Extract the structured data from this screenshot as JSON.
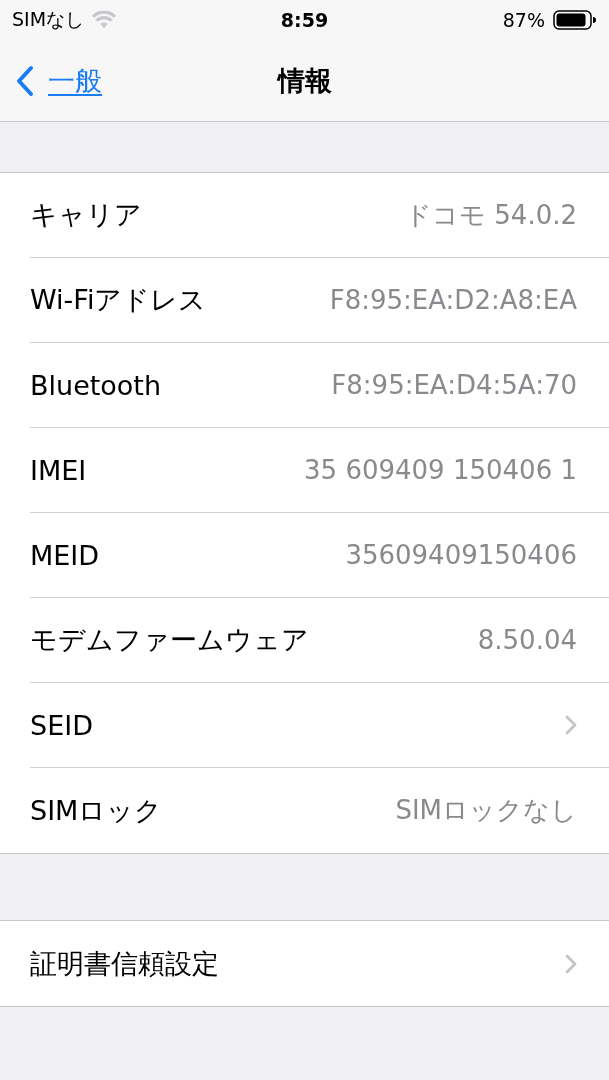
{
  "status_bar": {
    "carrier": "SIMなし",
    "time": "8:59",
    "battery": "87%"
  },
  "nav": {
    "back": "一般",
    "title": "情報"
  },
  "sections": [
    {
      "rows": [
        {
          "kind": "value",
          "label": "キャリア",
          "value": "ドコモ 54.0.2"
        },
        {
          "kind": "value",
          "label": "Wi-Fiアドレス",
          "value": "F8:95:EA:D2:A8:EA"
        },
        {
          "kind": "value",
          "label": "Bluetooth",
          "value": "F8:95:EA:D4:5A:70"
        },
        {
          "kind": "value",
          "label": "IMEI",
          "value": "35 609409 150406 1"
        },
        {
          "kind": "value",
          "label": "MEID",
          "value": "35609409150406"
        },
        {
          "kind": "value",
          "label": "モデムファームウェア",
          "value": "8.50.04"
        },
        {
          "kind": "disclosure",
          "label": "SEID"
        },
        {
          "kind": "value",
          "label": "SIMロック",
          "value": "SIMロックなし"
        }
      ]
    },
    {
      "rows": [
        {
          "kind": "disclosure",
          "label": "証明書信頼設定"
        }
      ]
    }
  ]
}
